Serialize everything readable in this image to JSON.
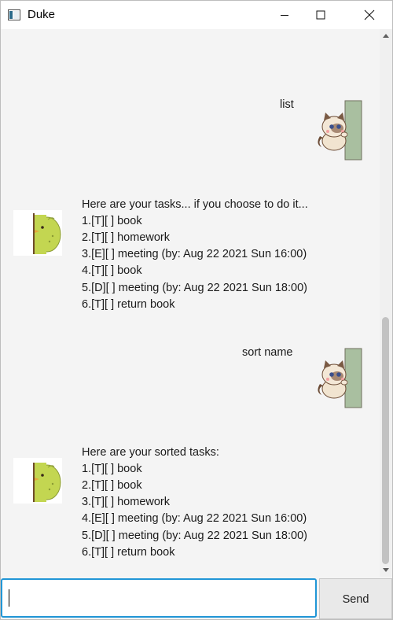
{
  "window": {
    "title": "Duke"
  },
  "messages": [
    {
      "sender": "user",
      "text": "list",
      "avatar": "cat-avatar-icon"
    },
    {
      "sender": "duke",
      "avatar": "green-chick-avatar-icon",
      "lines": [
        "Here are your tasks... if you choose to do it...",
        "1.[T][ ] book",
        "2.[T][ ] homework",
        "3.[E][ ] meeting (by: Aug 22 2021 Sun 16:00)",
        "4.[T][ ] book",
        "5.[D][ ] meeting (by: Aug 22 2021 Sun 18:00)",
        "6.[T][ ] return book"
      ]
    },
    {
      "sender": "user",
      "text": "sort name",
      "avatar": "cat-avatar-icon"
    },
    {
      "sender": "duke",
      "avatar": "green-chick-avatar-icon",
      "lines": [
        "Here are your sorted tasks:",
        "1.[T][ ] book",
        "2.[T][ ] book",
        "3.[T][ ] homework",
        "4.[E][ ] meeting (by: Aug 22 2021 Sun 16:00)",
        "5.[D][ ] meeting (by: Aug 22 2021 Sun 18:00)",
        "6.[T][ ] return book"
      ]
    }
  ],
  "input": {
    "value": "",
    "placeholder": ""
  },
  "send_button": {
    "label": "Send"
  },
  "colors": {
    "input_focus_border": "#2196d6",
    "chat_background": "#f4f4f4",
    "duke_avatar_green": "#c3d651",
    "cat_avatar_wall": "#a9bfa0"
  }
}
